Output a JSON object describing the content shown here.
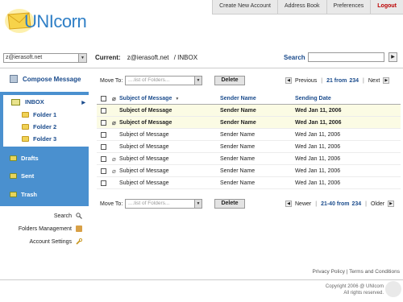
{
  "app": {
    "logo_text": "UNIcorn"
  },
  "topnav": [
    "Create New Account",
    "Address Book",
    "Preferences",
    "Logout"
  ],
  "account": {
    "selected": "z@ierasoft.net"
  },
  "breadcrumb": {
    "label": "Current:",
    "email": "z@ierasoft.net",
    "path": "/ INBOX"
  },
  "search": {
    "label": "Search",
    "value": ""
  },
  "sidebar": {
    "compose": "Compose Message",
    "inbox": "INBOX",
    "folders": [
      "Folder 1",
      "Folder 2",
      "Folder 3"
    ],
    "others": [
      "Drafts",
      "Sent",
      "Trash"
    ],
    "links": [
      "Search",
      "Folders Management",
      "Account Settings"
    ]
  },
  "toolbar_top": {
    "move_to": "Move To:",
    "folder_placeholder": "....list of Folders...",
    "delete": "Delete",
    "prev": "Previous",
    "range": "21 from",
    "total": "234",
    "next": "Next"
  },
  "toolbar_bottom": {
    "move_to": "Move To:",
    "folder_placeholder": "....list of Folders...",
    "delete": "Delete",
    "prev": "Newer",
    "range": "21-40 from",
    "total": "234",
    "next": "Older"
  },
  "table": {
    "headers": {
      "subject": "Subject of Message",
      "sender": "Sender Name",
      "date": "Sending Date"
    },
    "rows": [
      {
        "subject": "Subject of Message",
        "sender": "Sender Name",
        "date": "Wed Jan 11, 2006",
        "unread": true,
        "attachment": false
      },
      {
        "subject": "Subject of Message",
        "sender": "Sender Name",
        "date": "Wed Jan 11, 2006",
        "unread": true,
        "attachment": true
      },
      {
        "subject": "Subject of Message",
        "sender": "Sender Name",
        "date": "Wed Jan 11, 2006",
        "unread": false,
        "attachment": false
      },
      {
        "subject": "Subject of Message",
        "sender": "Sender Name",
        "date": "Wed Jan 11, 2006",
        "unread": false,
        "attachment": false
      },
      {
        "subject": "Subject of Message",
        "sender": "Sender Name",
        "date": "Wed Jan 11, 2006",
        "unread": false,
        "attachment": true
      },
      {
        "subject": "Subject of Message",
        "sender": "Sender Name",
        "date": "Wed Jan 11, 2006",
        "unread": false,
        "attachment": true
      },
      {
        "subject": "Subject of Message",
        "sender": "Sender Name",
        "date": "Wed Jan 11, 2006",
        "unread": false,
        "attachment": false
      }
    ]
  },
  "footer": {
    "links": "Privacy Policy | Terms and Conditions",
    "copyright_line1": "Copyright 2006 @ UNIcorn",
    "copyright_line2": "All rights reserved."
  },
  "colors": {
    "accent": "#4a90cf",
    "link": "#1a4b8c",
    "unread_row": "#fbfbe4",
    "logout": "#bb0000"
  }
}
